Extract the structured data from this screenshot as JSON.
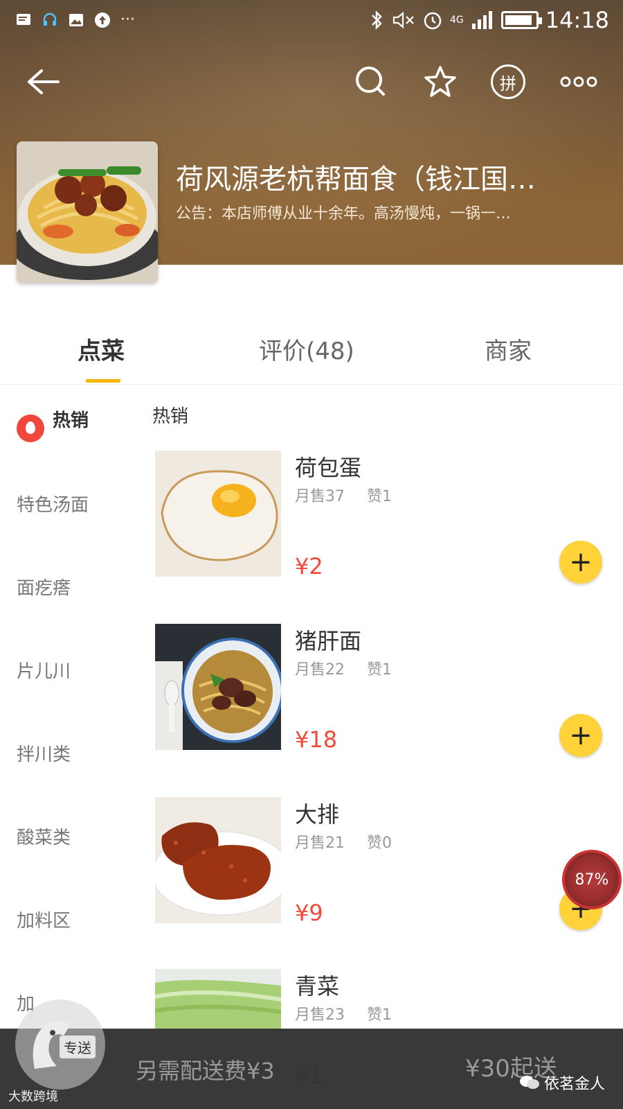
{
  "status_bar": {
    "time": "14:18",
    "network": "4G",
    "left_icons": [
      "message-icon",
      "headset-icon",
      "image-icon",
      "upload-icon"
    ],
    "overflow": "···"
  },
  "store": {
    "name": "荷风源老杭帮面食（钱江国…",
    "notice": "公告：本店师傅从业十余年。高汤慢炖，一锅一…"
  },
  "nav": {
    "back": "back-arrow-icon",
    "search": "search-icon",
    "favorite": "star-icon",
    "group": "拼",
    "more": "more-icon"
  },
  "tabs": [
    {
      "label": "点菜",
      "active": true
    },
    {
      "label": "评价(48)",
      "active": false
    },
    {
      "label": "商家",
      "active": false
    }
  ],
  "sidebar": {
    "categories": [
      {
        "label": "热销",
        "active": true
      },
      {
        "label": "特色汤面",
        "active": false
      },
      {
        "label": "面疙瘩",
        "active": false
      },
      {
        "label": "片儿川",
        "active": false
      },
      {
        "label": "拌川类",
        "active": false
      },
      {
        "label": "酸菜类",
        "active": false
      },
      {
        "label": "加料区",
        "active": false
      },
      {
        "label": "加",
        "active": false
      }
    ]
  },
  "menu": {
    "section_title": "热销",
    "items": [
      {
        "name": "荷包蛋",
        "monthly_sales": "月售37",
        "likes": "赞1",
        "price": "¥2",
        "add": "+"
      },
      {
        "name": "猪肝面",
        "monthly_sales": "月售22",
        "likes": "赞1",
        "price": "¥18",
        "add": "+"
      },
      {
        "name": "大排",
        "monthly_sales": "月售21",
        "likes": "赞0",
        "price": "¥9",
        "add": "+"
      },
      {
        "name": "青菜",
        "monthly_sales": "月售23",
        "likes": "赞1",
        "price": "¥1",
        "add": "+"
      }
    ]
  },
  "overlay_badge": "87%",
  "bottom_bar": {
    "delivery_fee": "另需配送费¥3",
    "minimum_order": "¥30起送",
    "cart_tag": "专送"
  },
  "watermarks": {
    "left": "大数跨境",
    "right": "依茗金人"
  },
  "colors": {
    "accent": "#f5b800",
    "price": "#f04a3a",
    "add_button": "#ffd23a",
    "hot_icon": "#f0463c",
    "bottom_bar": "#2c2c2c"
  }
}
